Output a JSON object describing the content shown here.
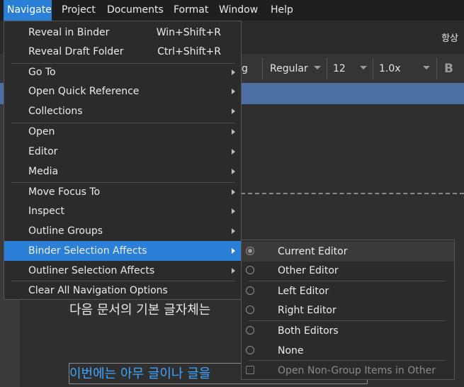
{
  "menubar": [
    "Navigate",
    "Project",
    "Documents",
    "Format",
    "Window",
    "Help"
  ],
  "toolbar": {
    "right_label": "항상",
    "font_family": "g",
    "font_style": "Regular",
    "font_size": "12",
    "line_spacing": "1.0x",
    "bold": "B"
  },
  "editor": {
    "line1": "다음 문서의 기본 글자체는",
    "line2": "이번에는 아무 글이나 글을"
  },
  "navigate_menu": [
    {
      "label": "Reveal in Binder",
      "shortcut": "Win+Shift+R"
    },
    {
      "label": "Reveal Draft Folder",
      "shortcut": "Ctrl+Shift+R"
    },
    {
      "label": "Go To"
    },
    {
      "label": "Open Quick Reference"
    },
    {
      "label": "Collections"
    },
    {
      "label": "Open"
    },
    {
      "label": "Editor"
    },
    {
      "label": "Media"
    },
    {
      "label": "Move Focus To"
    },
    {
      "label": "Inspect"
    },
    {
      "label": "Outline Groups"
    },
    {
      "label": "Binder Selection Affects"
    },
    {
      "label": "Outliner Selection Affects"
    },
    {
      "label": "Clear All Navigation Options"
    }
  ],
  "submenu": [
    {
      "label": "Current Editor",
      "selected": true
    },
    {
      "label": "Other Editor"
    },
    {
      "label": "Left Editor"
    },
    {
      "label": "Right Editor"
    },
    {
      "label": "Both Editors"
    },
    {
      "label": "None"
    },
    {
      "label": "Open Non-Group Items in Other",
      "disabled": true
    }
  ]
}
